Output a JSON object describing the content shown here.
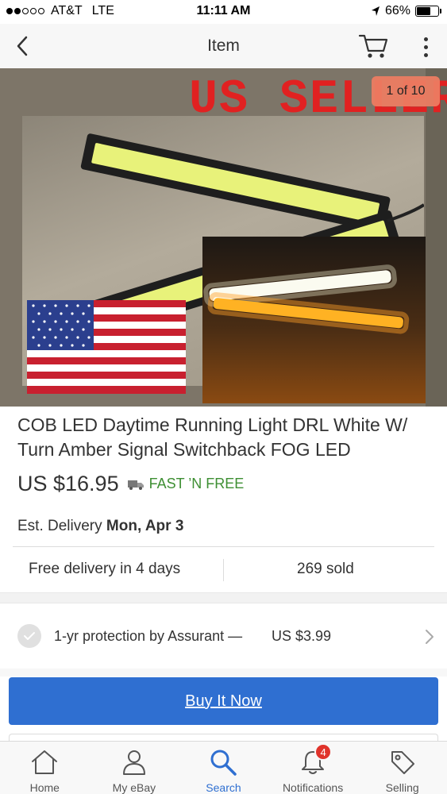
{
  "status_bar": {
    "carrier": "AT&T",
    "network": "LTE",
    "time": "11:11 AM",
    "battery": "66%",
    "battery_level": 0.66
  },
  "nav": {
    "title": "Item"
  },
  "hero": {
    "banner_text": "US SELLER",
    "photo_counter": "1 of 10"
  },
  "item": {
    "title": "COB LED Daytime Running Light DRL White W/ Turn Amber Signal Switchback FOG LED",
    "price": "US $16.95",
    "shipping": "FAST ’N FREE",
    "delivery_label": "Est. Delivery",
    "delivery_date": "Mon, Apr 3",
    "free_delivery": "Free delivery in 4 days",
    "sold": "269 sold"
  },
  "protection": {
    "text": "1-yr protection by Assurant —",
    "price": "US $3.99"
  },
  "actions": {
    "buy_now": "Buy It Now"
  },
  "tabs": [
    {
      "label": "Home",
      "icon": "home-icon"
    },
    {
      "label": "My eBay",
      "icon": "person-icon"
    },
    {
      "label": "Search",
      "icon": "search-icon",
      "active": true
    },
    {
      "label": "Notifications",
      "icon": "bell-icon",
      "badge": "4"
    },
    {
      "label": "Selling",
      "icon": "tag-icon"
    }
  ],
  "colors": {
    "accent": "#2f6fd1",
    "shipping_green": "#3e8f33",
    "badge_red": "#e0332b",
    "banner_red": "#e12121"
  }
}
